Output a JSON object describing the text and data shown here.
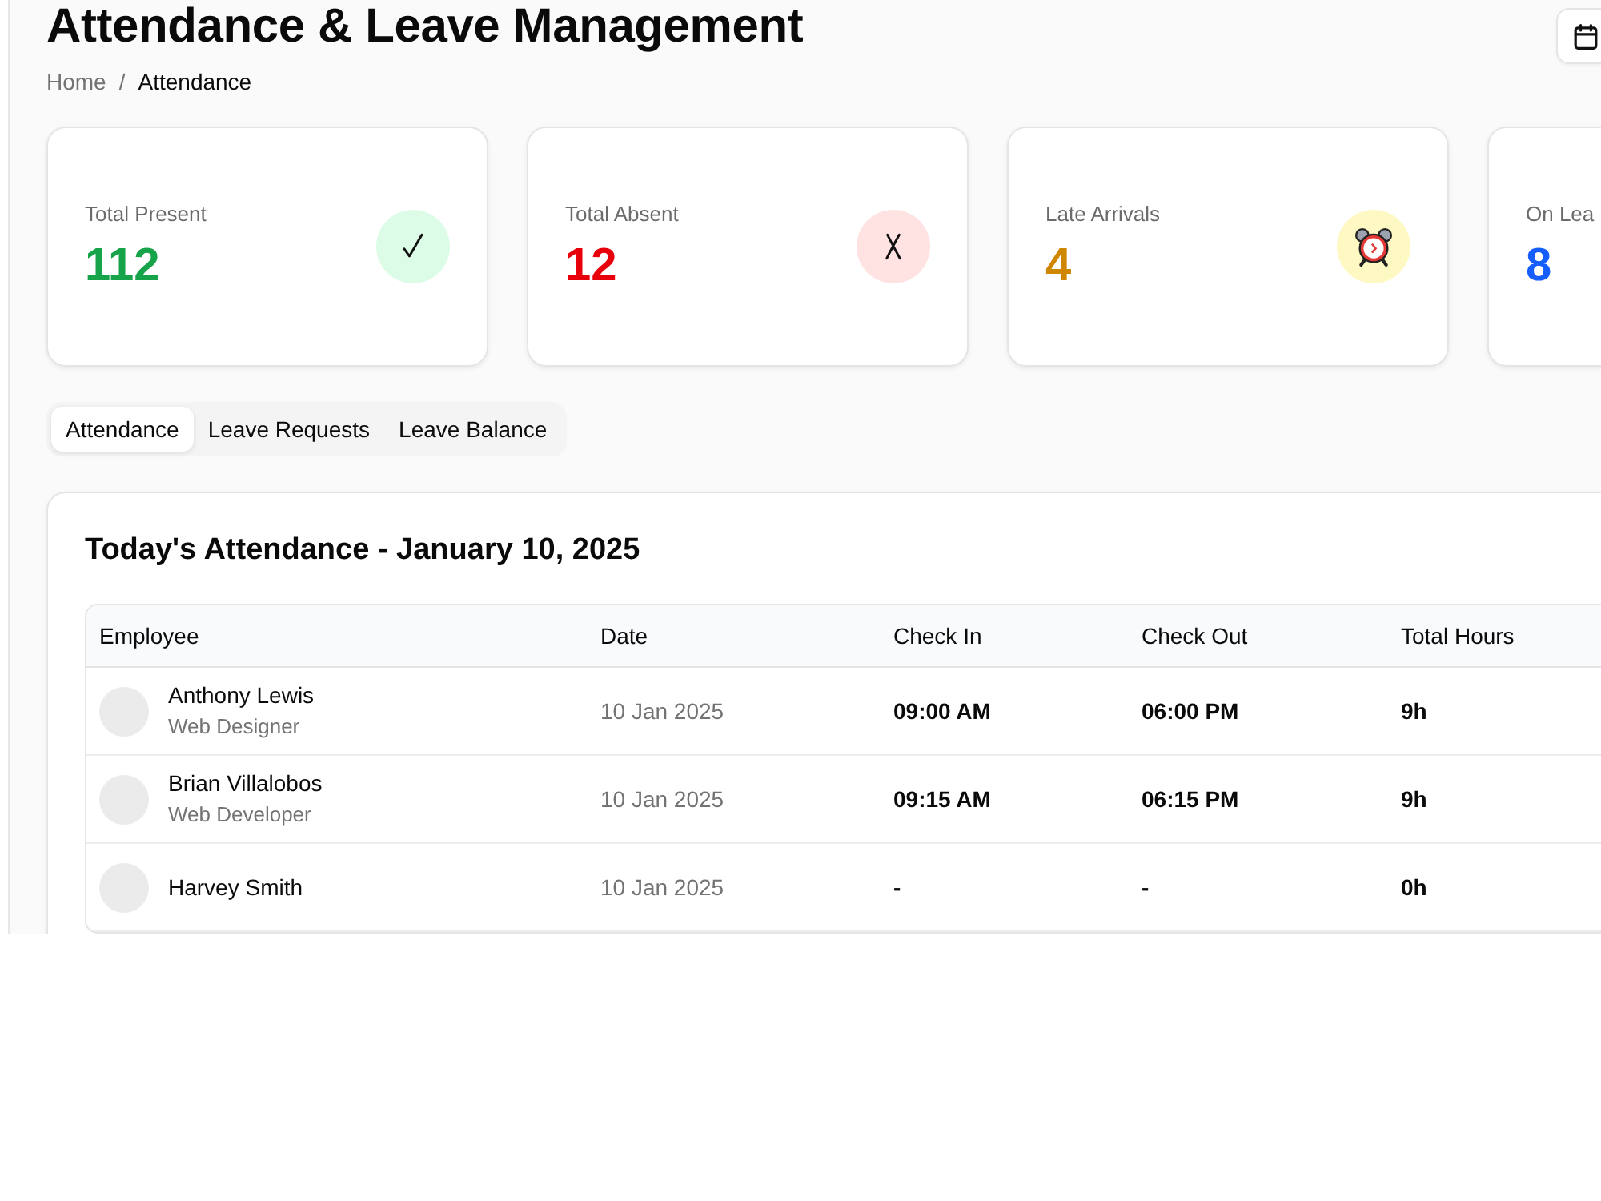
{
  "page": {
    "title": "Attendance & Leave Management",
    "breadcrumb": {
      "separator": "/",
      "items": [
        {
          "label": "Home",
          "current": false
        },
        {
          "label": "Attendance",
          "current": true
        }
      ]
    }
  },
  "stats": [
    {
      "kind": "present",
      "label": "Total Present",
      "value": "112",
      "color": "#16a34a"
    },
    {
      "kind": "absent",
      "label": "Total Absent",
      "value": "12",
      "color": "#e7000b"
    },
    {
      "kind": "late",
      "label": "Late Arrivals",
      "value": "4",
      "color": "#d08700"
    },
    {
      "kind": "leave",
      "label": "On Lea",
      "value": "8",
      "color": "#155dfc"
    }
  ],
  "tabs": [
    {
      "label": "Attendance",
      "selected": true
    },
    {
      "label": "Leave Requests",
      "selected": false
    },
    {
      "label": "Leave Balance",
      "selected": false
    }
  ],
  "attendance": {
    "title": "Today's Attendance - January 10, 2025",
    "columns": [
      "Employee",
      "Date",
      "Check In",
      "Check Out",
      "Total Hours"
    ],
    "rows": [
      {
        "name": "Anthony Lewis",
        "role": "Web Designer",
        "date": "10 Jan 2025",
        "check_in": "09:00 AM",
        "check_out": "06:00 PM",
        "total_hours": "9h"
      },
      {
        "name": "Brian Villalobos",
        "role": "Web Developer",
        "date": "10 Jan 2025",
        "check_in": "09:15 AM",
        "check_out": "06:15 PM",
        "total_hours": "9h"
      },
      {
        "name": "Harvey Smith",
        "date": "10 Jan 2025",
        "check_in": "-",
        "check_out": "-",
        "total_hours": "0h"
      }
    ]
  }
}
